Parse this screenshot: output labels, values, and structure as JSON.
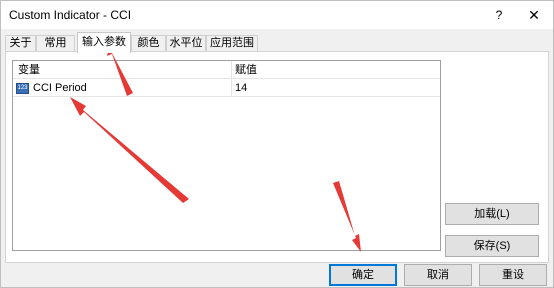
{
  "window": {
    "title": "Custom Indicator - CCI",
    "help_glyph": "?",
    "close_glyph": "✕"
  },
  "tabs": [
    {
      "label": "关于"
    },
    {
      "label": "常用"
    },
    {
      "label": "输入参数",
      "active": true
    },
    {
      "label": "颜色"
    },
    {
      "label": "水平位"
    },
    {
      "label": "应用范围"
    }
  ],
  "grid": {
    "columns": [
      "变量",
      "赋值"
    ],
    "rows": [
      {
        "icon": "param-icon",
        "name": "CCI Period",
        "value": "14"
      }
    ]
  },
  "side_buttons": {
    "load": "加载(L)",
    "save": "保存(S)"
  },
  "bottom_buttons": {
    "ok": "确定",
    "cancel": "取消",
    "reset": "重设"
  },
  "colors": {
    "accent": "#0078d7",
    "annotation_arrow": "#e53935"
  }
}
